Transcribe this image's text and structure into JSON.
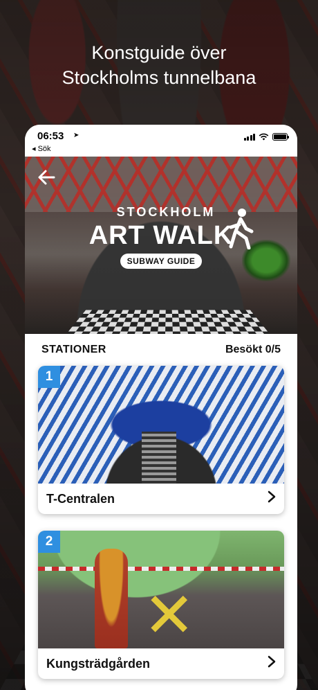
{
  "headline": {
    "line1": "Konstguide över",
    "line2": "Stockholms tunnelbana"
  },
  "status_bar": {
    "time": "06:53",
    "back_app": "◂ Sök"
  },
  "hero": {
    "logo_line1": "STOCKHOLM",
    "logo_line2": "ART WALK",
    "badge": "SUBWAY GUIDE"
  },
  "list": {
    "title": "STATIONER",
    "visited": "Besökt 0/5",
    "stations": [
      {
        "number": "1",
        "name": "T-Centralen"
      },
      {
        "number": "2",
        "name": "Kungsträdgården"
      }
    ]
  },
  "colors": {
    "badge_blue": "#2f8fe0",
    "text_dark": "#111111"
  },
  "icons": [
    "location-arrow-icon",
    "signal-icon",
    "wifi-icon",
    "battery-icon",
    "back-arrow-icon",
    "walker-icon",
    "chevron-right-icon"
  ]
}
